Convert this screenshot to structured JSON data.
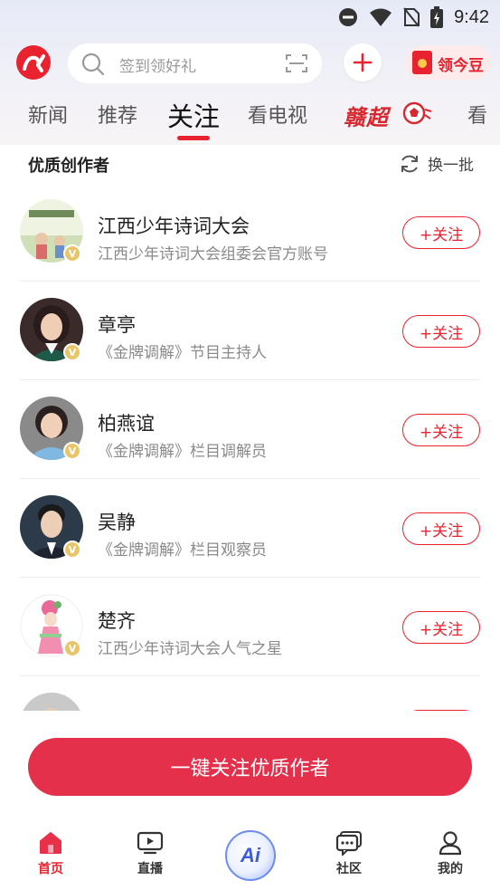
{
  "status_bar": {
    "time": "9:42"
  },
  "top_bar": {
    "search_placeholder": "签到领好礼",
    "bean_label": "领今豆"
  },
  "tabs": [
    "新闻",
    "推荐",
    "关注",
    "看电视",
    "赣超",
    "看"
  ],
  "active_tab": "关注",
  "section": {
    "title": "优质创作者",
    "refresh_label": "换一批"
  },
  "authors": [
    {
      "name": "江西少年诗词大会",
      "desc": "江西少年诗词大会组委会官方账号",
      "follow_label": "+关注"
    },
    {
      "name": "章亭",
      "desc": "《金牌调解》节目主持人",
      "follow_label": "+关注"
    },
    {
      "name": "柏燕谊",
      "desc": "《金牌调解》栏目调解员",
      "follow_label": "+关注"
    },
    {
      "name": "吴静",
      "desc": "《金牌调解》栏目观察员",
      "follow_label": "+关注"
    },
    {
      "name": "楚齐",
      "desc": "江西少年诗词大会人气之星",
      "follow_label": "+关注"
    }
  ],
  "follow_all_label": "一键关注优质作者",
  "bottom_nav": {
    "home": "首页",
    "live": "直播",
    "ai": "Ai",
    "community": "社区",
    "mine": "我的"
  },
  "colors": {
    "accent": "#e8232f",
    "button": "#e4304a",
    "verified": "#e9c56a"
  }
}
